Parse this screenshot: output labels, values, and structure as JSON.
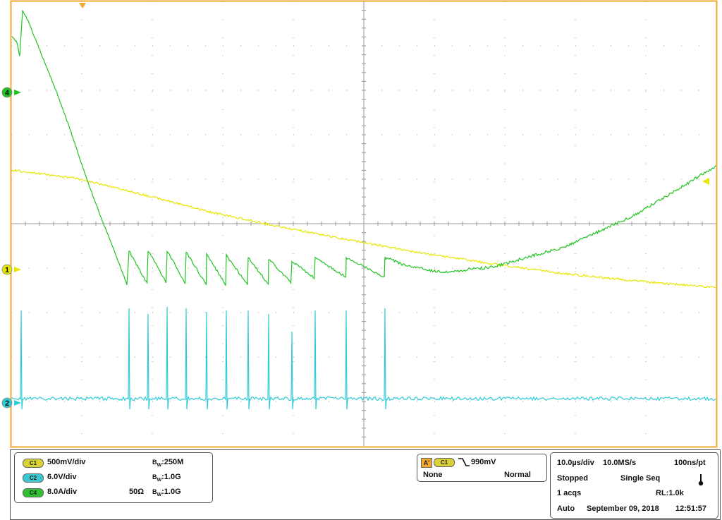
{
  "colors": {
    "ch1": "#e6e600",
    "ch2": "#2ecbd6",
    "ch4": "#22c422",
    "frame": "#f0a830",
    "grid": "#999999",
    "badge_ch1": "#d8d238",
    "badge_ch2": "#3ac8d0",
    "badge_ch4": "#30c030",
    "badge_a": "#f0a830"
  },
  "markers": {
    "ch4": "4",
    "ch1": "1",
    "ch2": "2"
  },
  "channels": [
    {
      "badge": "C1",
      "scale": "500mV/div",
      "impedance": "",
      "bw_b": "B",
      "bw_w": "W",
      "bw_value": ":250M"
    },
    {
      "badge": "C2",
      "scale": "6.0V/div",
      "impedance": "",
      "bw_b": "B",
      "bw_w": "W",
      "bw_value": ":1.0G"
    },
    {
      "badge": "C4",
      "scale": "8.0A/div",
      "impedance": "50Ω",
      "bw_b": "B",
      "bw_w": "W",
      "bw_value": ":1.0G"
    }
  ],
  "trigger": {
    "badge_a": "A'",
    "badge_source": "C1",
    "edge_icon": "falling-edge-icon",
    "level": "990mV",
    "coupling": "None",
    "mode": "Normal"
  },
  "acquisition": {
    "timebase": "10.0µs/div",
    "sample_rate": "10.0MS/s",
    "resolution": "100ns/pt",
    "state": "Stopped",
    "sequence": "Single Seq",
    "icon": "thermometer-icon",
    "acqs": "1 acqs",
    "record_length": "RL:1.0k",
    "mode": "Auto",
    "date": "September 09, 2018",
    "time": "12:51:57"
  }
}
